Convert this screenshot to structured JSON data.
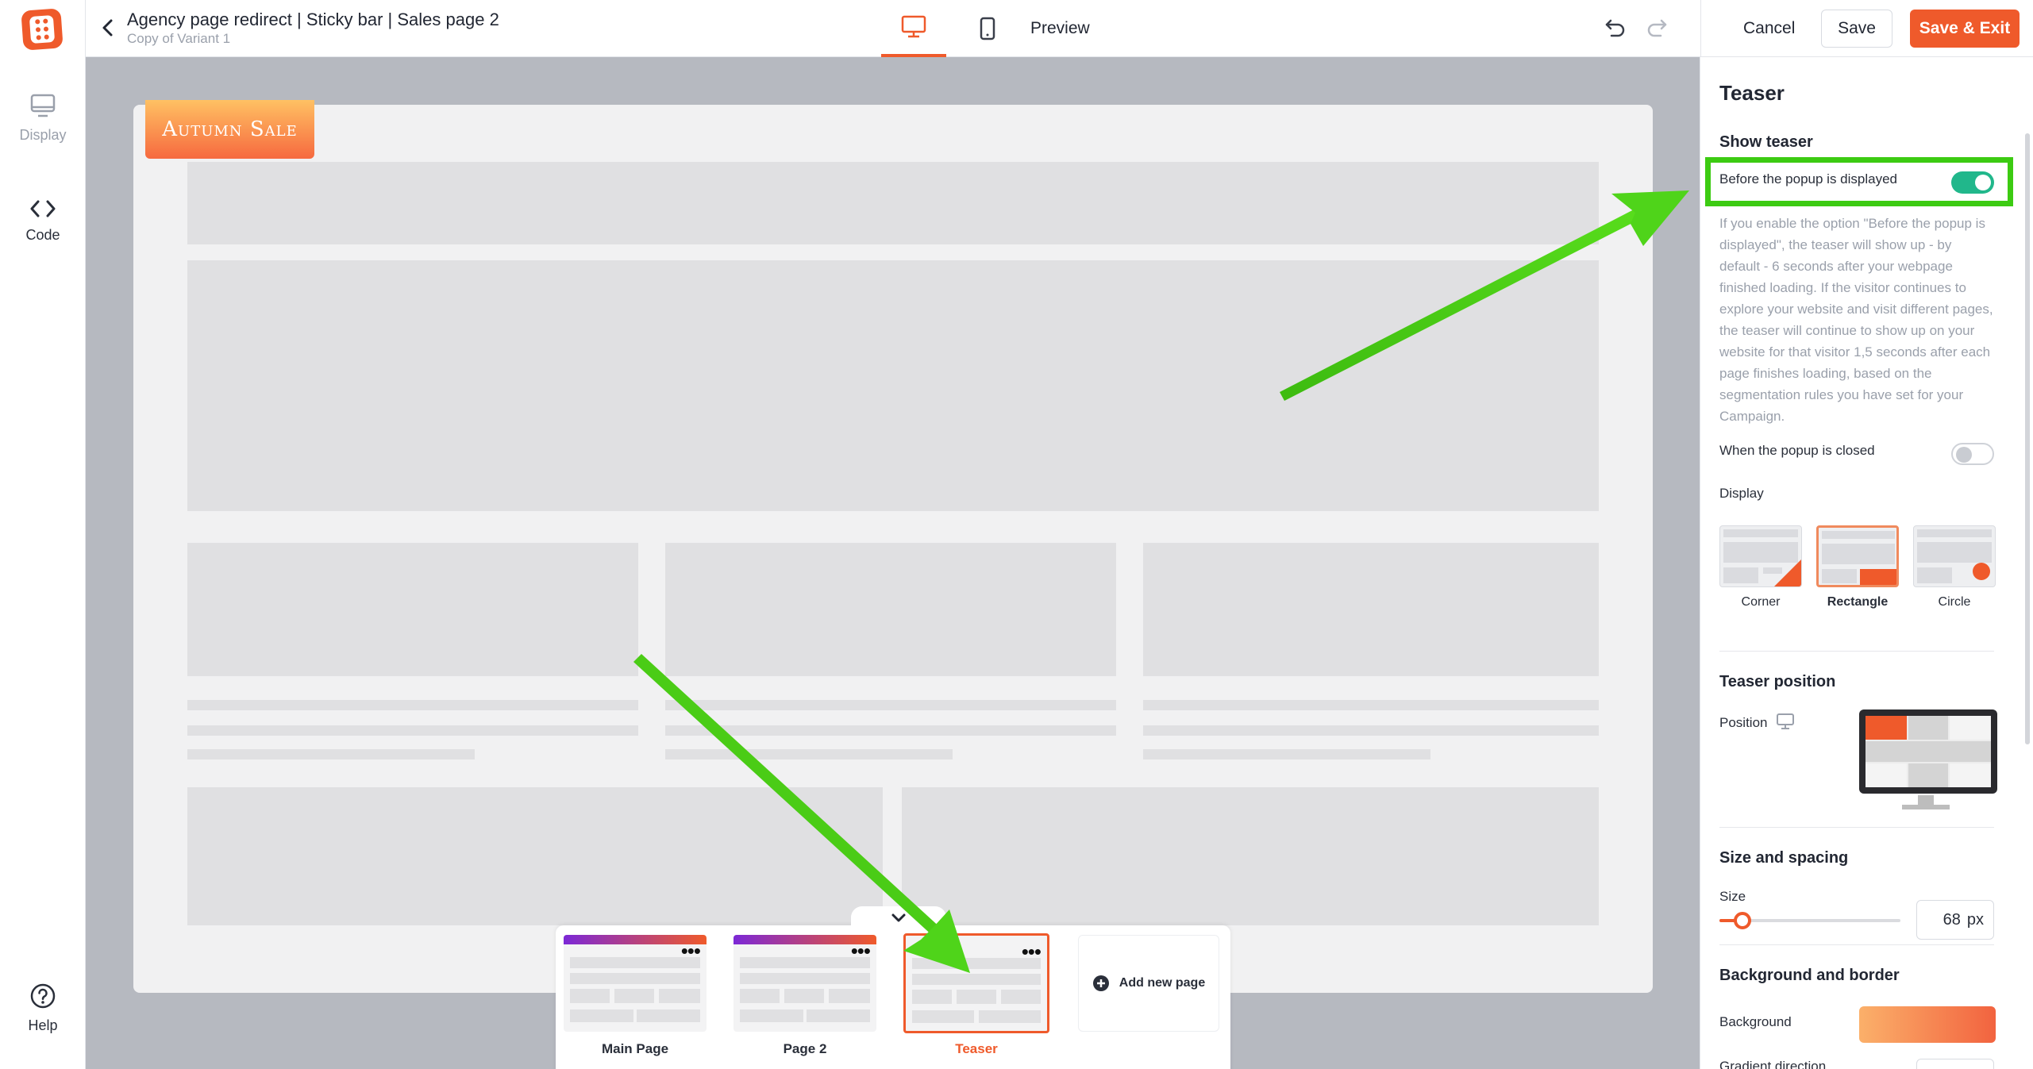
{
  "left_rail": {
    "items": [
      {
        "label": "Display",
        "icon": "display-icon"
      },
      {
        "label": "Code",
        "icon": "code-icon"
      }
    ],
    "help_label": "Help"
  },
  "header": {
    "title": "Agency page redirect | Sticky bar | Sales page 2",
    "subtitle": "Copy of Variant 1",
    "preview_label": "Preview",
    "cancel_label": "Cancel",
    "save_label": "Save",
    "save_exit_label": "Save & Exit"
  },
  "canvas": {
    "teaser_text": "Autumn Sale"
  },
  "pages": {
    "items": [
      {
        "label": "Main Page"
      },
      {
        "label": "Page 2"
      },
      {
        "label": "Teaser"
      }
    ],
    "add_label": "Add new page"
  },
  "panel": {
    "title": "Teaser",
    "show_teaser": {
      "title": "Show teaser",
      "before_label": "Before the popup is displayed",
      "before_enabled": true,
      "help_text": "If you enable the option \"Before the popup is displayed\", the teaser will show up - by default - 6 seconds after your webpage finished loading. If the visitor continues to explore your website and visit different pages, the teaser will continue to show up on your website for that visitor 1,5 seconds after each page finishes loading, based on the segmentation rules you have set for your Campaign.",
      "closed_label": "When the popup is closed",
      "closed_enabled": false
    },
    "display": {
      "label": "Display",
      "options": [
        "Corner",
        "Rectangle",
        "Circle"
      ],
      "selected": "Rectangle"
    },
    "position": {
      "title": "Teaser position",
      "label": "Position"
    },
    "size": {
      "title": "Size and spacing",
      "label": "Size",
      "value": "68",
      "unit": "px"
    },
    "background": {
      "title": "Background and border",
      "label": "Background",
      "gradient_from": "#fbb06a",
      "gradient_to": "#f2633f",
      "next_label": "Gradient direction"
    }
  },
  "colors": {
    "accent": "#ef5a2b",
    "toggle_on": "#21b78b",
    "annotation": "#3ccb12"
  }
}
